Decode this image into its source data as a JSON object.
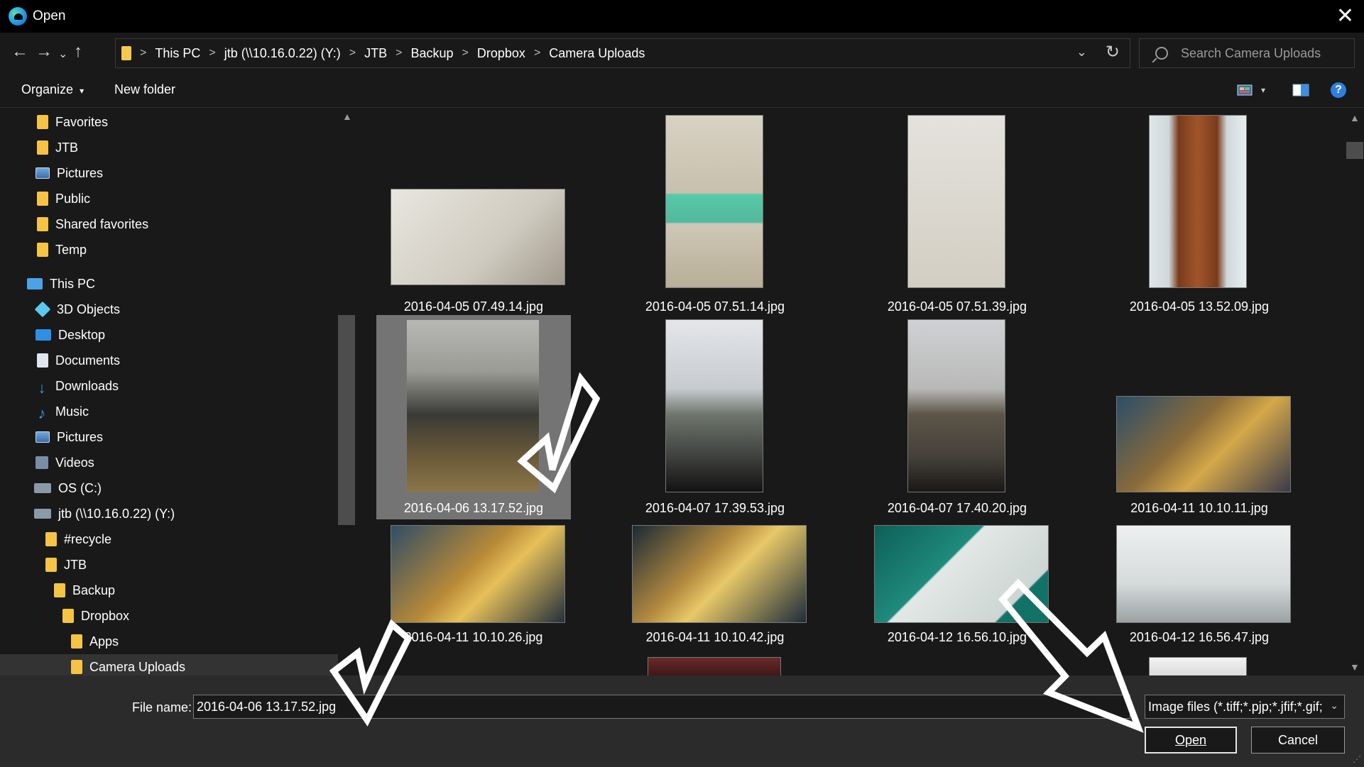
{
  "window": {
    "title": "Open",
    "close_icon": "close-icon"
  },
  "address": {
    "crumbs": [
      "This PC",
      "jtb (\\\\10.16.0.22) (Y:)",
      "JTB",
      "Backup",
      "Dropbox",
      "Camera Uploads"
    ],
    "separator": ">",
    "dropdown": "⌄",
    "refresh": "↻"
  },
  "search": {
    "placeholder": "Search Camera Uploads"
  },
  "toolbar": {
    "organize": "Organize",
    "organize_arrow": "▾",
    "new_folder": "New folder",
    "help": "?"
  },
  "sidebar": {
    "items": [
      {
        "label": "Favorites",
        "icon": "folder-icon"
      },
      {
        "label": "JTB",
        "icon": "folder-icon"
      },
      {
        "label": "Pictures",
        "icon": "pictures-icon"
      },
      {
        "label": "Public",
        "icon": "folder-icon"
      },
      {
        "label": "Shared favorites",
        "icon": "folder-icon"
      },
      {
        "label": "Temp",
        "icon": "folder-icon"
      },
      {
        "label": "This PC",
        "icon": "pc-icon"
      },
      {
        "label": "3D Objects",
        "icon": "cube-icon"
      },
      {
        "label": "Desktop",
        "icon": "desktop-icon"
      },
      {
        "label": "Documents",
        "icon": "document-icon"
      },
      {
        "label": "Downloads",
        "icon": "download-icon"
      },
      {
        "label": "Music",
        "icon": "music-icon"
      },
      {
        "label": "Pictures",
        "icon": "pictures-icon"
      },
      {
        "label": "Videos",
        "icon": "video-icon"
      },
      {
        "label": "OS (C:)",
        "icon": "drive-icon"
      },
      {
        "label": "jtb (\\\\10.16.0.22) (Y:)",
        "icon": "network-drive-icon"
      },
      {
        "label": "#recycle",
        "icon": "folder-icon"
      },
      {
        "label": "JTB",
        "icon": "folder-icon"
      },
      {
        "label": "Backup",
        "icon": "folder-icon"
      },
      {
        "label": "Dropbox",
        "icon": "folder-icon"
      },
      {
        "label": "Apps",
        "icon": "folder-icon"
      },
      {
        "label": "Camera Uploads",
        "icon": "folder-icon",
        "selected": true
      }
    ]
  },
  "files": [
    {
      "name": "2016-04-05 07.49.14.jpg"
    },
    {
      "name": "2016-04-05 07.51.14.jpg"
    },
    {
      "name": "2016-04-05 07.51.39.jpg"
    },
    {
      "name": "2016-04-05 13.52.09.jpg"
    },
    {
      "name": "2016-04-06 13.17.52.jpg",
      "selected": true
    },
    {
      "name": "2016-04-07 17.39.53.jpg"
    },
    {
      "name": "2016-04-07 17.40.20.jpg"
    },
    {
      "name": "2016-04-11 10.10.11.jpg"
    },
    {
      "name": "2016-04-11 10.10.26.jpg"
    },
    {
      "name": "2016-04-11 10.10.42.jpg"
    },
    {
      "name": "2016-04-12 16.56.10.jpg"
    },
    {
      "name": "2016-04-12 16.56.47.jpg"
    }
  ],
  "footer": {
    "filename_label": "File name:",
    "filename_value": "2016-04-06 13.17.52.jpg",
    "filetype": "Image files (*.tiff;*.pjp;*.jfif;*.gif;",
    "open": "Open",
    "cancel": "Cancel"
  },
  "colors": {
    "background": "#191919",
    "titlebar": "#000000",
    "footer": "#2b2b2b",
    "selection": "#747474",
    "folder": "#f5c445"
  }
}
